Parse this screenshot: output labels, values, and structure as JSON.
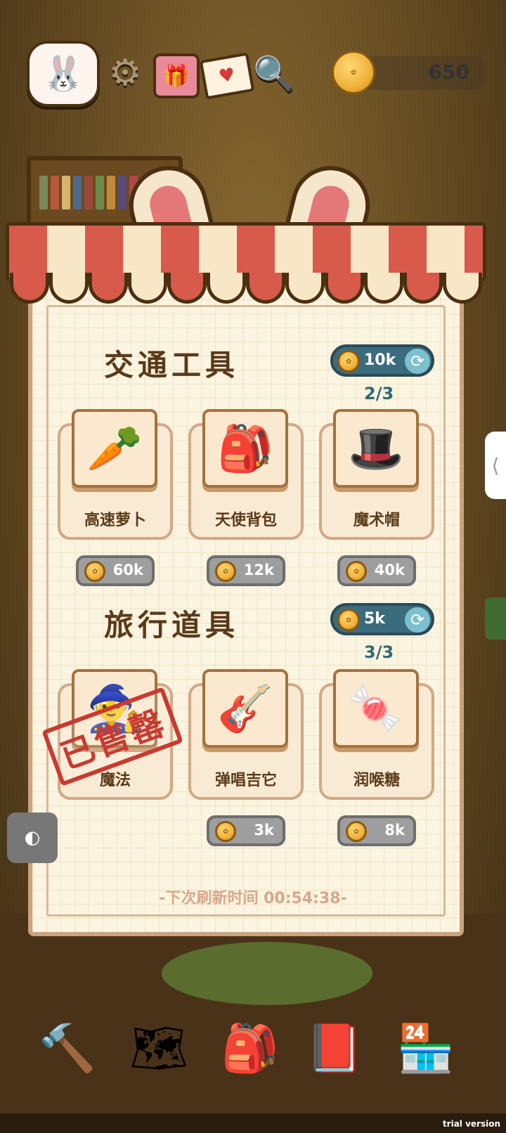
{
  "top_bar": {
    "avatar_icon": "bunny-face",
    "settings_icon": "gear",
    "gift_icon": "gift",
    "mail_icon": "mail-heart",
    "search_icon": "magnifier",
    "coin_balance": "650"
  },
  "shop": {
    "sections": [
      {
        "title": "交通工具",
        "refresh_cost": "10k",
        "count": "2/3",
        "items": [
          {
            "name": "高速萝卜",
            "price": "60k",
            "icon": "carrot-rocket"
          },
          {
            "name": "天使背包",
            "price": "12k",
            "icon": "angel-backpack"
          },
          {
            "name": "魔术帽",
            "price": "40k",
            "icon": "magic-hat"
          }
        ]
      },
      {
        "title": "旅行道具",
        "refresh_cost": "5k",
        "count": "3/3",
        "items": [
          {
            "name": "魔法",
            "price": "",
            "icon": "wizard-hat",
            "sold_out": true,
            "stamp": "已售罄"
          },
          {
            "name": "弹唱吉它",
            "price": "3k",
            "icon": "guitar"
          },
          {
            "name": "润喉糖",
            "price": "8k",
            "icon": "candy"
          }
        ]
      }
    ],
    "refresh_timer": "-下次刷新时间 00:54:38-"
  },
  "side_tab_glyph": "⟨",
  "float_button_glyph": "◐",
  "bottom_nav": [
    "tools",
    "map",
    "backpack",
    "book",
    "shop"
  ],
  "watermark": "trial version"
}
